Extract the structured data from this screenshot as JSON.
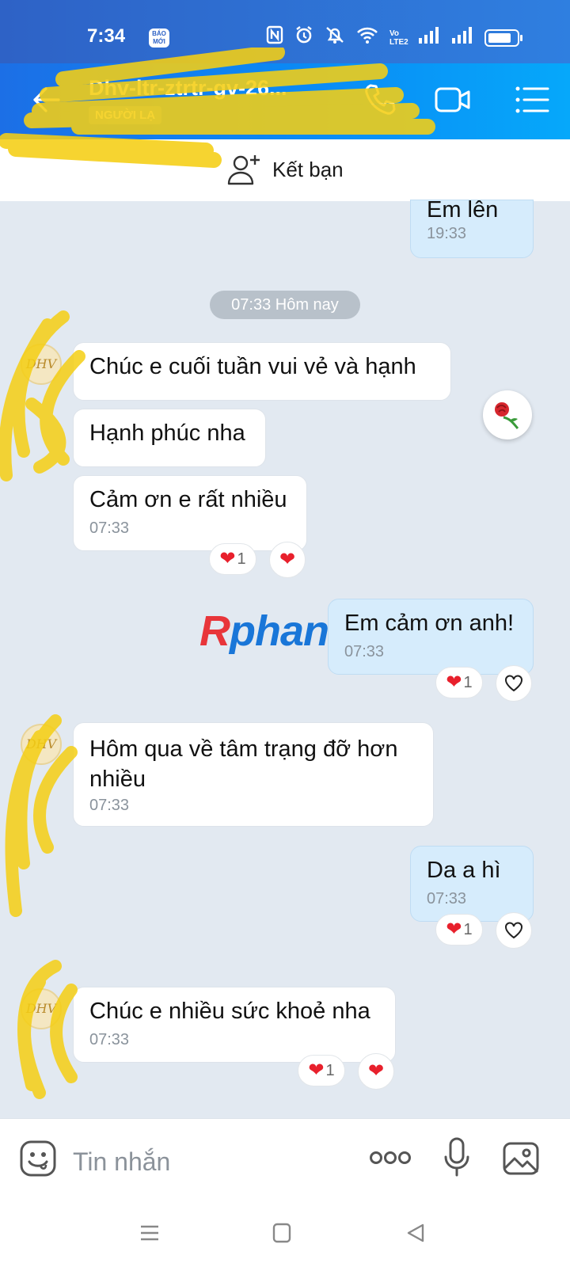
{
  "status_bar": {
    "time": "7:34",
    "baomoi_badge": "BÁO MỚI",
    "icons": [
      "nfc-icon",
      "alarm-icon",
      "mute-icon",
      "wifi-icon",
      "volte-icon",
      "signal-icon",
      "signal-icon",
      "battery-icon"
    ],
    "volte_text": "Vo LTE2"
  },
  "header": {
    "title": "Dhv-ltr-ztrtr-gv-26...",
    "badge": "NGƯỜI LẠ",
    "actions": [
      "call-icon",
      "video-call-icon",
      "menu-icon"
    ]
  },
  "friend_bar": {
    "label": "Kết bạn"
  },
  "messages": {
    "m1": {
      "text": "Em lên",
      "time": "19:33"
    },
    "day_divider": "07:33 Hôm nay",
    "m2": {
      "text": "Chúc e cuối tuần vui vẻ và hạnh"
    },
    "m3": {
      "text": "Hạnh phúc nha"
    },
    "m4": {
      "text": "Cảm ơn e rất nhiều",
      "time": "07:33",
      "reaction_count": "1"
    },
    "m5": {
      "text": "Em cảm ơn anh!",
      "time": "07:33",
      "reaction_count": "1"
    },
    "m6": {
      "text": "Hôm qua về tâm trạng đỡ hơn nhiều",
      "time": "07:33"
    },
    "m7": {
      "text": "Da a hì",
      "time": "07:33",
      "reaction_count": "1"
    },
    "m8": {
      "text": "Chúc e nhiều sức khoẻ nha",
      "time": "07:33",
      "reaction_count": "1"
    },
    "avatar_text": "DHV"
  },
  "watermark": {
    "r": "R",
    "rest": "phang"
  },
  "composer": {
    "placeholder": "Tin nhắn"
  },
  "colors": {
    "header_start": "#1c6fe6",
    "header_end": "#06a8fa",
    "outgoing_bubble": "#d6ecfc",
    "incoming_bubble": "#ffffff",
    "chat_background": "#e2e9f1",
    "heart": "#e8202c",
    "scribble": "#f5cf14"
  }
}
